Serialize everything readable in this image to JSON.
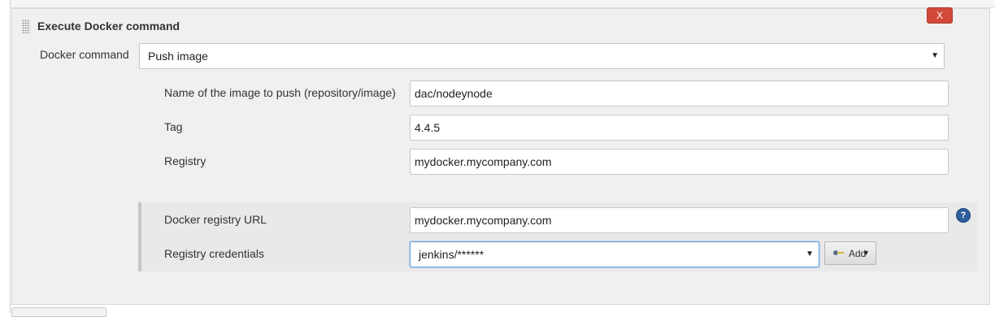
{
  "section": {
    "title": "Execute Docker command",
    "delete_label": "X"
  },
  "command": {
    "label": "Docker command",
    "selected": "Push image"
  },
  "fields": {
    "image_label": "Name of the image to push (repository/image)",
    "image_value": "dac/nodeynode",
    "tag_label": "Tag",
    "tag_value": "4.4.5",
    "registry_label": "Registry",
    "registry_value": "mydocker.mycompany.com"
  },
  "credentials": {
    "url_label": "Docker registry URL",
    "url_value": "mydocker.mycompany.com",
    "help_glyph": "?",
    "creds_label": "Registry credentials",
    "creds_selected": "jenkins/******",
    "add_label": "Add"
  },
  "icons": {
    "drag": "drag-handle-icon",
    "help": "help-icon",
    "key": "key-icon",
    "caret": "chevron-down-icon"
  },
  "colors": {
    "delete_button": "#d24939",
    "help_icon": "#2e5f9c",
    "panel_background": "#f0f0f0",
    "credentials_background": "#e9e9e9",
    "focus_border": "#5b9bd5"
  }
}
